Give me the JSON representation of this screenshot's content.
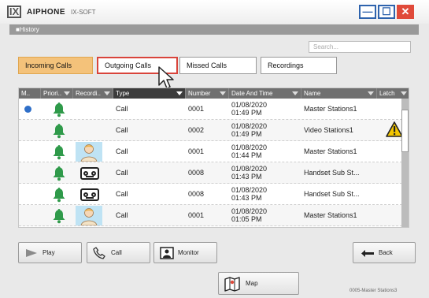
{
  "app": {
    "brand": "AIPHONE",
    "product": "IX-SOFT",
    "logo": "IX"
  },
  "window": {
    "min": "—",
    "max": "☐",
    "close": "✕"
  },
  "history_bar": "■History",
  "search": {
    "placeholder": "Search..."
  },
  "tabs": [
    {
      "label": "Incoming Calls",
      "active": true
    },
    {
      "label": "Outgoing Calls",
      "active": false,
      "highlighted": true
    },
    {
      "label": "Missed Calls",
      "active": false
    },
    {
      "label": "Recordings",
      "active": false
    }
  ],
  "table": {
    "headers": [
      "M..",
      "Priori..",
      "Recordi..",
      "Type",
      "Number",
      "Date And Time",
      "Name",
      "Latch"
    ],
    "rows": [
      {
        "unread": true,
        "priority": "bell-icon",
        "recording": "",
        "type": "Call",
        "number": "0001",
        "date": "01/08/2020",
        "time": "01:49 PM",
        "name": "Master Stations1",
        "latch": ""
      },
      {
        "unread": false,
        "priority": "bell-icon",
        "recording": "",
        "type": "Call",
        "number": "0002",
        "date": "01/08/2020",
        "time": "01:49 PM",
        "name": "Video Stations1",
        "latch": "warning-icon"
      },
      {
        "unread": false,
        "priority": "bell-icon",
        "recording": "thumbnail",
        "type": "Call",
        "number": "0001",
        "date": "01/08/2020",
        "time": "01:44 PM",
        "name": "Master Stations1",
        "latch": ""
      },
      {
        "unread": false,
        "priority": "bell-icon",
        "recording": "voicemail-icon",
        "type": "Call",
        "number": "0008",
        "date": "01/08/2020",
        "time": "01:43 PM",
        "name": "Handset Sub St...",
        "latch": ""
      },
      {
        "unread": false,
        "priority": "bell-icon",
        "recording": "voicemail-icon",
        "type": "Call",
        "number": "0008",
        "date": "01/08/2020",
        "time": "01:43 PM",
        "name": "Handset Sub St...",
        "latch": ""
      },
      {
        "unread": false,
        "priority": "bell-icon",
        "recording": "thumbnail",
        "type": "Call",
        "number": "0001",
        "date": "01/08/2020",
        "time": "01:05 PM",
        "name": "Master Stations1",
        "latch": ""
      }
    ]
  },
  "buttons": {
    "play": "Play",
    "call": "Call",
    "monitor": "Monitor",
    "back": "Back",
    "map": "Map"
  },
  "status": "0005-Master Stations3",
  "colors": {
    "accent_tab": "#f4c27a",
    "bell": "#2f9a4a",
    "unread_dot": "#2f6fc8",
    "close": "#e04a3a",
    "highlight": "#d9443b",
    "warning": "#f2c500"
  }
}
